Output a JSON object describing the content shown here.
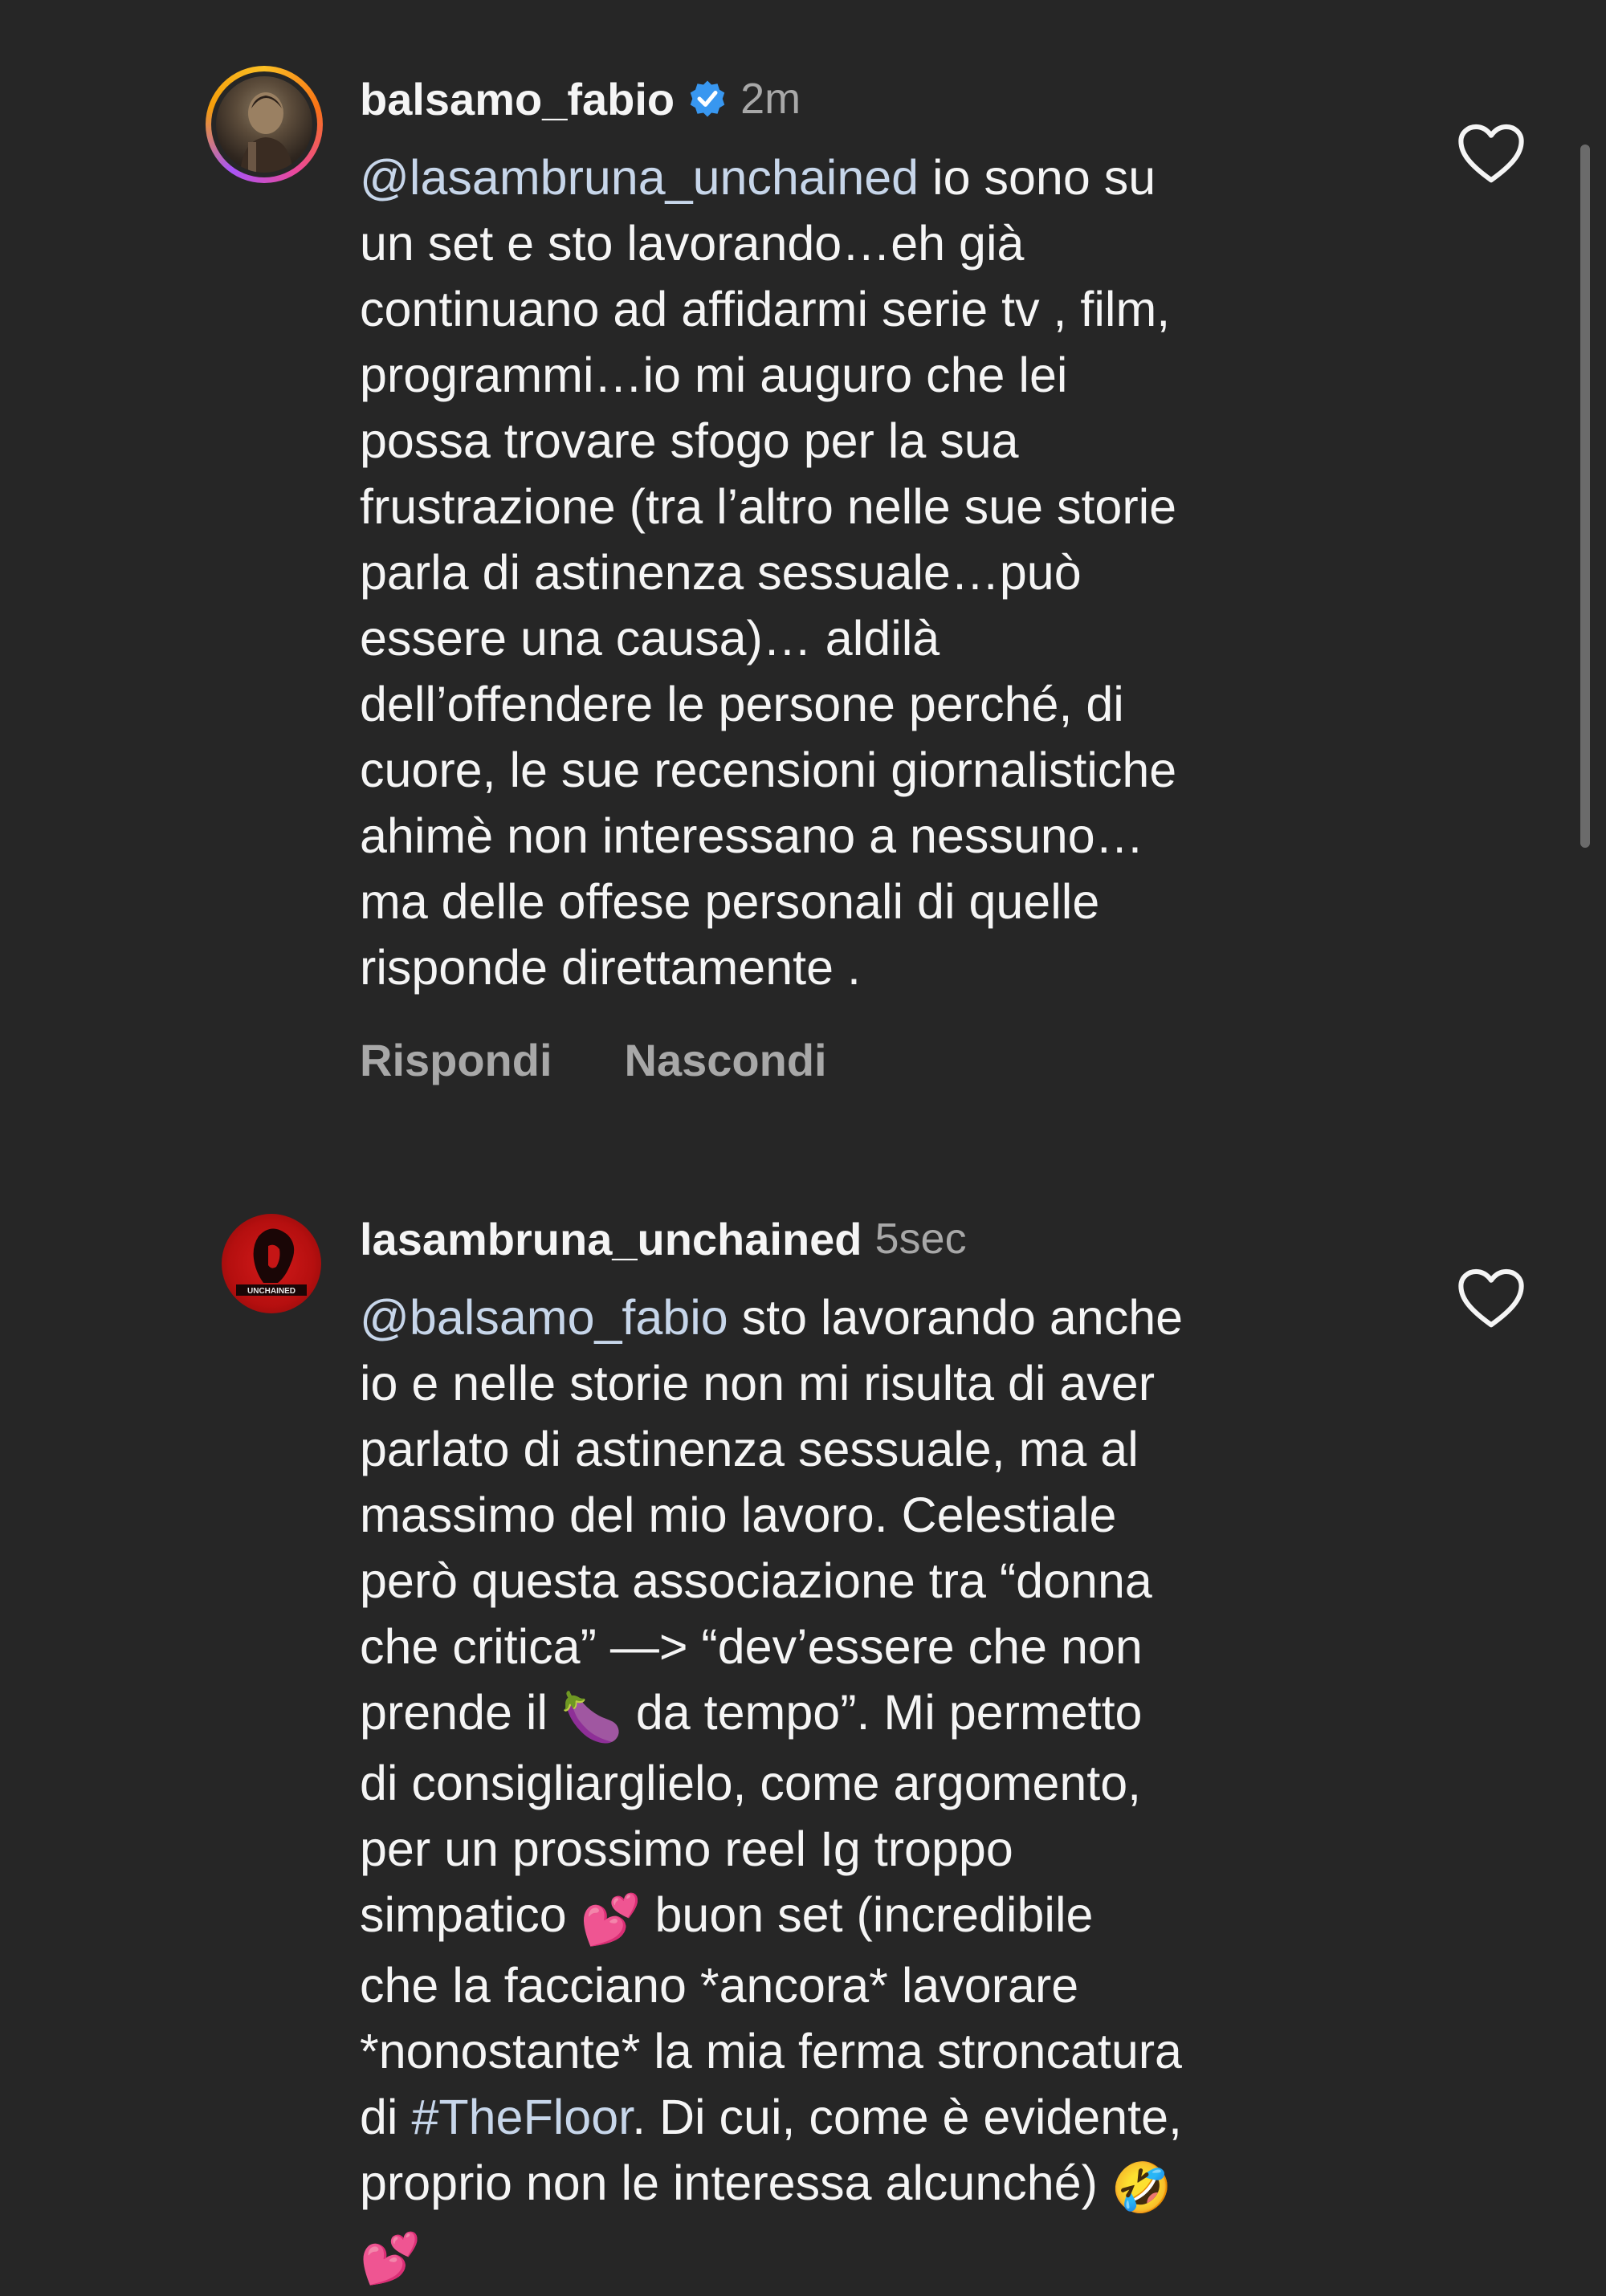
{
  "comments": [
    {
      "username": "balsamo_fabio",
      "verified": true,
      "time": "2m",
      "mention": "@lasambruna_unchained",
      "text_lines": [
        " io sono su",
        "un set e sto lavorando…eh già",
        "continuano ad affidarmi serie tv , film,",
        "programmi…io mi auguro che lei",
        "possa trovare sfogo per la sua",
        "frustrazione (tra l’altro nelle sue storie",
        "parla di astinenza sessuale…può",
        "essere una causa)… aldilà",
        "dell’offendere le persone perché, di",
        "cuore, le sue recensioni giornalistiche",
        "ahimè non interessano a nessuno…",
        "ma delle offese personali di quelle",
        "risponde direttamente ."
      ],
      "actions": {
        "reply": "Rispondi",
        "hide": "Nascondi"
      },
      "avatar": "profile-photo-icon",
      "like_icon": "heart-outline-icon"
    },
    {
      "username": "lasambruna_unchained",
      "verified": false,
      "time": "5sec",
      "mention": "@balsamo_fabio",
      "avatar_text": "UNCHAINED",
      "segments": {
        "l1": " sto lavorando anche",
        "l2": "io e nelle storie non mi risulta di aver",
        "l3": "parlato di astinenza sessuale, ma al",
        "l4": "massimo del mio lavoro. Celestiale",
        "l5": "però questa associazione tra “donna",
        "l6": "che critica” —> “dev’essere che non",
        "l7a": "prende il ",
        "eggplant": "🍆",
        "l7b": " da tempo”. Mi permetto",
        "l8": "di consigliarglielo, come argomento,",
        "l9": "per un prossimo reel Ig troppo",
        "l10a": "simpatico ",
        "hearts1": "💕",
        "l10b": " buon set (incredibile",
        "l11": "che la facciano *ancora* lavorare",
        "l12": "*nonostante* la mia ferma stroncatura",
        "l13a": "di ",
        "hashtag": "#TheFloor",
        "l13b": ". Di cui, come è evidente,",
        "l14a": "proprio non le interessa alcunché) ",
        "laugh": "🤣",
        "hearts2": "💕"
      },
      "like_icon": "heart-outline-icon"
    }
  ],
  "colors": {
    "background": "#262626",
    "text": "#f5f5f5",
    "secondary": "#a8a8a8",
    "mention": "#c7d6ea",
    "verified": "#3897f0"
  }
}
